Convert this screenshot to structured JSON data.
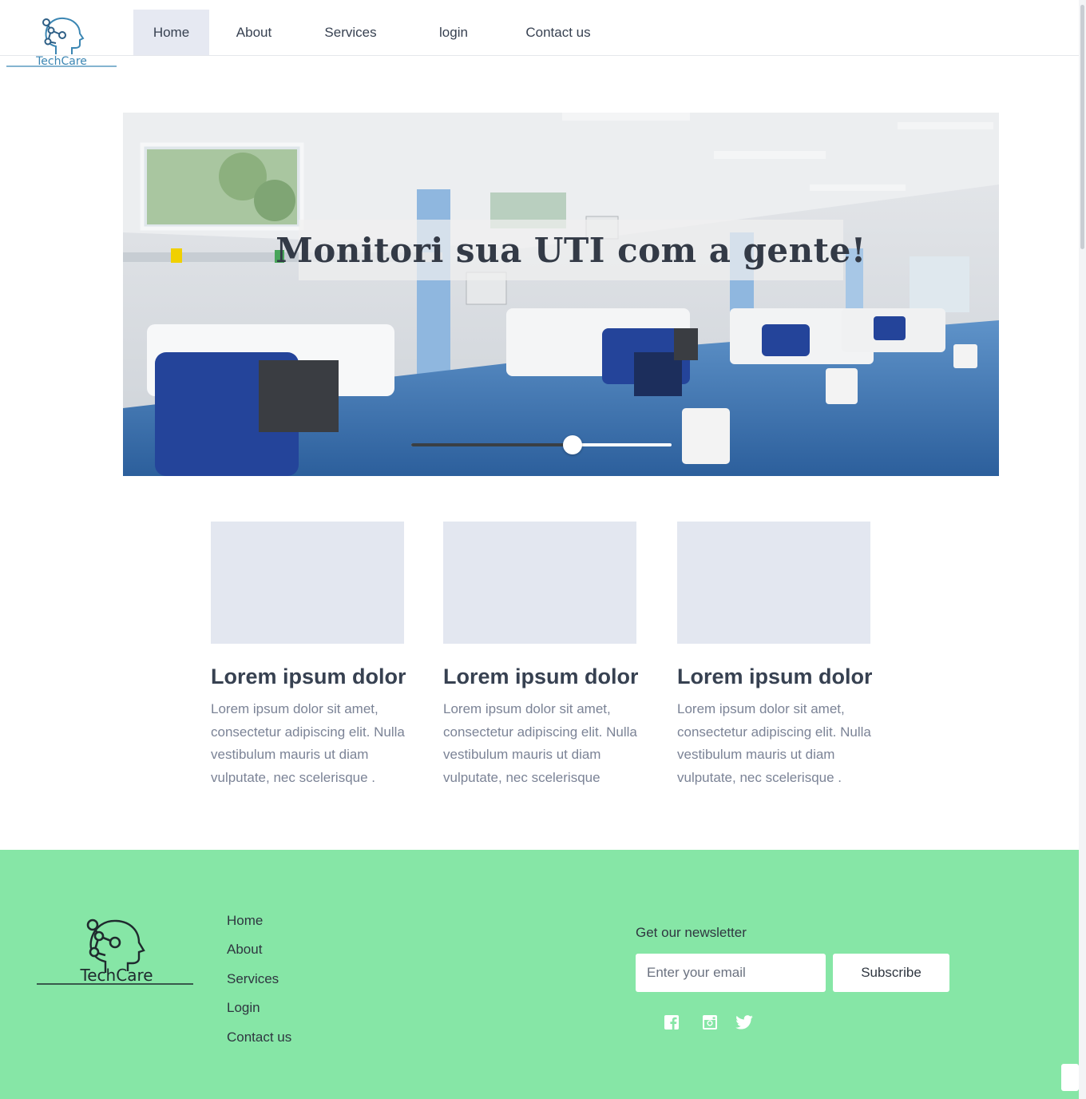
{
  "brand": {
    "name": "TechCare",
    "accent": "#3b86b3",
    "footer_bg": "#86e6a6"
  },
  "nav": {
    "items": [
      {
        "label": "Home",
        "active": true
      },
      {
        "label": "About",
        "active": false
      },
      {
        "label": "Services",
        "active": false
      },
      {
        "label": "login",
        "active": false
      },
      {
        "label": "Contact us",
        "active": false
      }
    ]
  },
  "hero": {
    "title": "Monitori sua UTI com a gente!",
    "image": "hospital-icu-ward-photo",
    "slider_value": 0.62
  },
  "cards": [
    {
      "title": "Lorem ipsum dolor",
      "text": "Lorem ipsum dolor sit amet, consectetur adipiscing elit. Nulla vestibulum mauris ut diam vulputate, nec scelerisque ."
    },
    {
      "title": "Lorem ipsum dolor",
      "text": "Lorem ipsum dolor sit amet, consectetur adipiscing elit. Nulla vestibulum mauris ut diam vulputate, nec scelerisque"
    },
    {
      "title": "Lorem ipsum dolor",
      "text": "Lorem ipsum dolor sit amet, consectetur adipiscing elit. Nulla vestibulum mauris ut diam vulputate, nec scelerisque ."
    }
  ],
  "footer": {
    "links": [
      "Home",
      "About",
      "Services",
      "Login",
      "Contact us"
    ],
    "newsletter": {
      "label": "Get our newsletter",
      "placeholder": "Enter your email",
      "button": "Subscribe"
    },
    "social_icons": [
      "facebook-icon",
      "instagram-icon",
      "twitter-icon"
    ]
  }
}
